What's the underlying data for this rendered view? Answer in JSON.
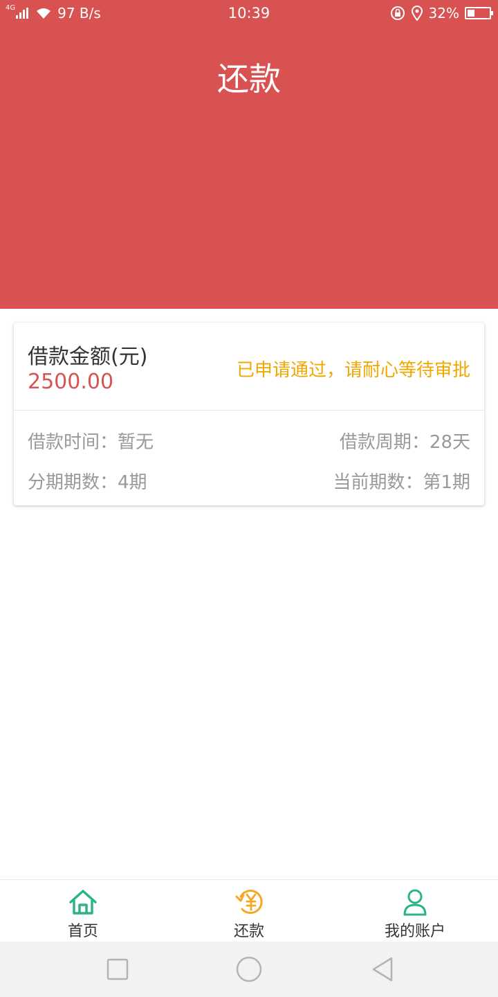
{
  "status_bar": {
    "network": "4G",
    "speed": "97 B/s",
    "time": "10:39",
    "battery": "32%",
    "battery_level": 0.32
  },
  "header": {
    "title": "还款"
  },
  "loan_card": {
    "amount_label": "借款金额(元)",
    "amount_value": "2500.00",
    "status": "已申请通过，请耐心等待审批",
    "loan_time": "借款时间：暂无",
    "loan_period": "借款周期：28天",
    "installments": "分期期数：4期",
    "current_installment": "当前期数：第1期"
  },
  "bottom_nav": {
    "items": [
      {
        "label": "首页",
        "icon": "home-icon"
      },
      {
        "label": "还款",
        "icon": "repay-yuan-icon"
      },
      {
        "label": "我的账户",
        "icon": "user-icon"
      }
    ]
  },
  "colors": {
    "brand": "#d95252",
    "status": "#f0a800",
    "nav_green": "#2bb38a",
    "nav_orange": "#f5a623"
  },
  "system_nav": [
    "square-icon",
    "circle-icon",
    "back-triangle-icon"
  ]
}
